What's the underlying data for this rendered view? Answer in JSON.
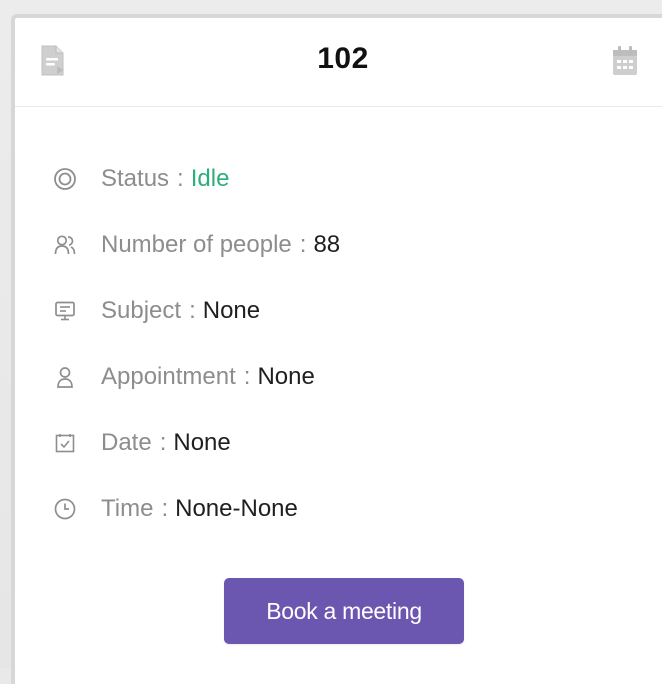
{
  "card": {
    "title": "102",
    "left_icon": "document-icon",
    "right_icon": "calendar-icon"
  },
  "details": [
    {
      "label": "Status",
      "separator": ":",
      "value": "Idle",
      "icon": "target-icon"
    },
    {
      "label": "Number of people",
      "separator": ":",
      "value": "88",
      "icon": "people-icon"
    },
    {
      "label": "Subject",
      "separator": ":",
      "value": "None",
      "icon": "monitor-icon"
    },
    {
      "label": "Appointment",
      "separator": ":",
      "value": "None",
      "icon": "person-icon"
    },
    {
      "label": "Date",
      "separator": ":",
      "value": "None",
      "icon": "date-check-icon"
    },
    {
      "label": "Time",
      "separator": ":",
      "value": "None-None",
      "icon": "clock-icon"
    }
  ],
  "actions": {
    "book_label": "Book a meeting"
  },
  "colors": {
    "status_idle": "#2fae7d",
    "button_bg": "#6b56b0"
  }
}
